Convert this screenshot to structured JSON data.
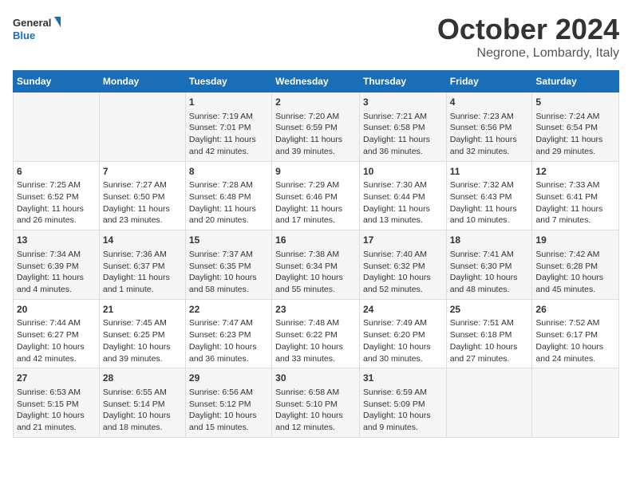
{
  "logo": {
    "general": "General",
    "blue": "Blue"
  },
  "title": "October 2024",
  "subtitle": "Negrone, Lombardy, Italy",
  "days_header": [
    "Sunday",
    "Monday",
    "Tuesday",
    "Wednesday",
    "Thursday",
    "Friday",
    "Saturday"
  ],
  "weeks": [
    [
      {
        "day": "",
        "info": ""
      },
      {
        "day": "",
        "info": ""
      },
      {
        "day": "1",
        "info": "Sunrise: 7:19 AM\nSunset: 7:01 PM\nDaylight: 11 hours and 42 minutes."
      },
      {
        "day": "2",
        "info": "Sunrise: 7:20 AM\nSunset: 6:59 PM\nDaylight: 11 hours and 39 minutes."
      },
      {
        "day": "3",
        "info": "Sunrise: 7:21 AM\nSunset: 6:58 PM\nDaylight: 11 hours and 36 minutes."
      },
      {
        "day": "4",
        "info": "Sunrise: 7:23 AM\nSunset: 6:56 PM\nDaylight: 11 hours and 32 minutes."
      },
      {
        "day": "5",
        "info": "Sunrise: 7:24 AM\nSunset: 6:54 PM\nDaylight: 11 hours and 29 minutes."
      }
    ],
    [
      {
        "day": "6",
        "info": "Sunrise: 7:25 AM\nSunset: 6:52 PM\nDaylight: 11 hours and 26 minutes."
      },
      {
        "day": "7",
        "info": "Sunrise: 7:27 AM\nSunset: 6:50 PM\nDaylight: 11 hours and 23 minutes."
      },
      {
        "day": "8",
        "info": "Sunrise: 7:28 AM\nSunset: 6:48 PM\nDaylight: 11 hours and 20 minutes."
      },
      {
        "day": "9",
        "info": "Sunrise: 7:29 AM\nSunset: 6:46 PM\nDaylight: 11 hours and 17 minutes."
      },
      {
        "day": "10",
        "info": "Sunrise: 7:30 AM\nSunset: 6:44 PM\nDaylight: 11 hours and 13 minutes."
      },
      {
        "day": "11",
        "info": "Sunrise: 7:32 AM\nSunset: 6:43 PM\nDaylight: 11 hours and 10 minutes."
      },
      {
        "day": "12",
        "info": "Sunrise: 7:33 AM\nSunset: 6:41 PM\nDaylight: 11 hours and 7 minutes."
      }
    ],
    [
      {
        "day": "13",
        "info": "Sunrise: 7:34 AM\nSunset: 6:39 PM\nDaylight: 11 hours and 4 minutes."
      },
      {
        "day": "14",
        "info": "Sunrise: 7:36 AM\nSunset: 6:37 PM\nDaylight: 11 hours and 1 minute."
      },
      {
        "day": "15",
        "info": "Sunrise: 7:37 AM\nSunset: 6:35 PM\nDaylight: 10 hours and 58 minutes."
      },
      {
        "day": "16",
        "info": "Sunrise: 7:38 AM\nSunset: 6:34 PM\nDaylight: 10 hours and 55 minutes."
      },
      {
        "day": "17",
        "info": "Sunrise: 7:40 AM\nSunset: 6:32 PM\nDaylight: 10 hours and 52 minutes."
      },
      {
        "day": "18",
        "info": "Sunrise: 7:41 AM\nSunset: 6:30 PM\nDaylight: 10 hours and 48 minutes."
      },
      {
        "day": "19",
        "info": "Sunrise: 7:42 AM\nSunset: 6:28 PM\nDaylight: 10 hours and 45 minutes."
      }
    ],
    [
      {
        "day": "20",
        "info": "Sunrise: 7:44 AM\nSunset: 6:27 PM\nDaylight: 10 hours and 42 minutes."
      },
      {
        "day": "21",
        "info": "Sunrise: 7:45 AM\nSunset: 6:25 PM\nDaylight: 10 hours and 39 minutes."
      },
      {
        "day": "22",
        "info": "Sunrise: 7:47 AM\nSunset: 6:23 PM\nDaylight: 10 hours and 36 minutes."
      },
      {
        "day": "23",
        "info": "Sunrise: 7:48 AM\nSunset: 6:22 PM\nDaylight: 10 hours and 33 minutes."
      },
      {
        "day": "24",
        "info": "Sunrise: 7:49 AM\nSunset: 6:20 PM\nDaylight: 10 hours and 30 minutes."
      },
      {
        "day": "25",
        "info": "Sunrise: 7:51 AM\nSunset: 6:18 PM\nDaylight: 10 hours and 27 minutes."
      },
      {
        "day": "26",
        "info": "Sunrise: 7:52 AM\nSunset: 6:17 PM\nDaylight: 10 hours and 24 minutes."
      }
    ],
    [
      {
        "day": "27",
        "info": "Sunrise: 6:53 AM\nSunset: 5:15 PM\nDaylight: 10 hours and 21 minutes."
      },
      {
        "day": "28",
        "info": "Sunrise: 6:55 AM\nSunset: 5:14 PM\nDaylight: 10 hours and 18 minutes."
      },
      {
        "day": "29",
        "info": "Sunrise: 6:56 AM\nSunset: 5:12 PM\nDaylight: 10 hours and 15 minutes."
      },
      {
        "day": "30",
        "info": "Sunrise: 6:58 AM\nSunset: 5:10 PM\nDaylight: 10 hours and 12 minutes."
      },
      {
        "day": "31",
        "info": "Sunrise: 6:59 AM\nSunset: 5:09 PM\nDaylight: 10 hours and 9 minutes."
      },
      {
        "day": "",
        "info": ""
      },
      {
        "day": "",
        "info": ""
      }
    ]
  ]
}
